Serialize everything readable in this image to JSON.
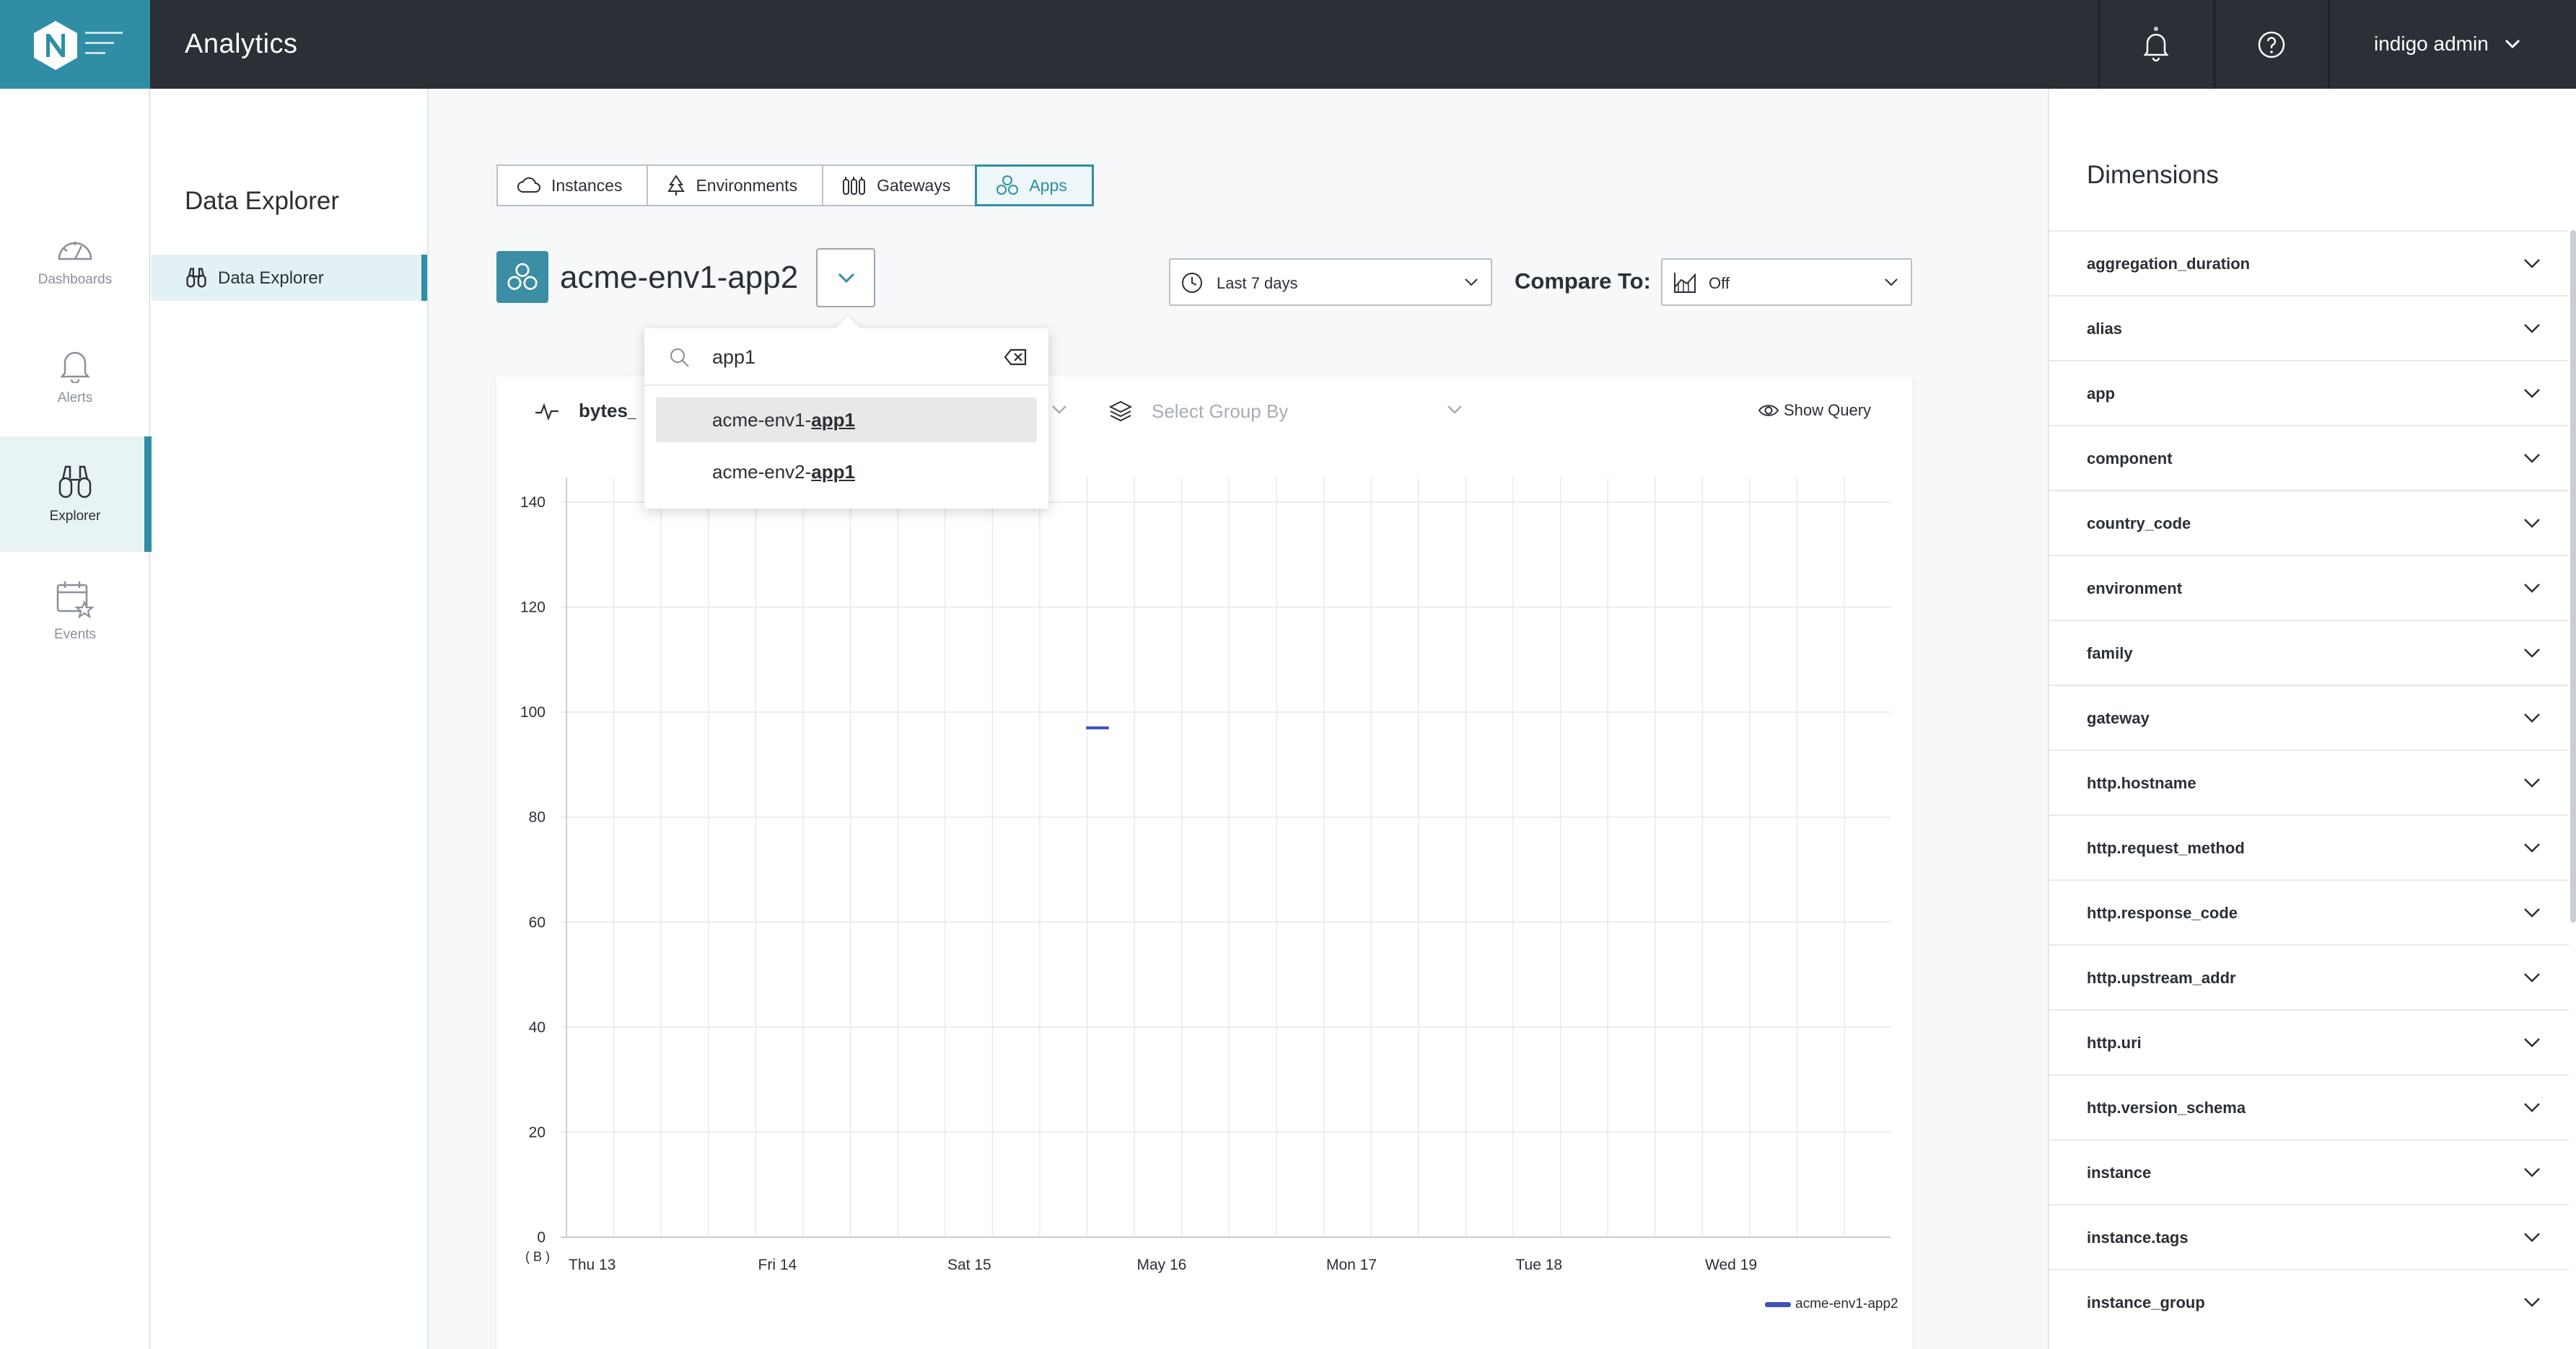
{
  "app": {
    "title": "Analytics",
    "logo_letter": "N",
    "user_name": "indigo admin",
    "accent_color": "#2f8ea5",
    "topbar_color": "#2b2f36",
    "icons": {
      "notifications": "bell-icon",
      "help": "help-icon",
      "menu": "menu-icon"
    }
  },
  "rail": {
    "items": [
      {
        "label": "Dashboards",
        "icon": "gauge-icon",
        "active": false
      },
      {
        "label": "Alerts",
        "icon": "bell-icon",
        "active": false
      },
      {
        "label": "Explorer",
        "icon": "binoculars-icon",
        "active": true
      },
      {
        "label": "Events",
        "icon": "calendar-star-icon",
        "active": false
      }
    ]
  },
  "subnav": {
    "title": "Data Explorer",
    "items": [
      {
        "label": "Data Explorer",
        "icon": "binoculars-icon",
        "active": true
      }
    ]
  },
  "tabs": [
    {
      "label": "Instances",
      "icon": "cloud-icon",
      "active": false
    },
    {
      "label": "Environments",
      "icon": "tree-icon",
      "active": false
    },
    {
      "label": "Gateways",
      "icon": "gateway-icon",
      "active": false
    },
    {
      "label": "Apps",
      "icon": "apps-icon",
      "active": true
    }
  ],
  "entity": {
    "name": "acme-env1-app2",
    "icon": "apps-icon"
  },
  "time_range": {
    "value": "Last 7 days",
    "icon": "clock-icon"
  },
  "compare": {
    "label": "Compare To:",
    "value": "Off",
    "icon": "area-chart-icon"
  },
  "dropdown": {
    "query": "app1",
    "options": [
      {
        "prefix": "acme-env1-",
        "match": "app1",
        "highlighted": true
      },
      {
        "prefix": "acme-env2-",
        "match": "app1",
        "highlighted": false
      }
    ]
  },
  "chart_toolbar": {
    "metric": "bytes_r",
    "group_by_placeholder": "Select Group By",
    "show_query_label": "Show Query"
  },
  "chart_data": {
    "type": "line",
    "x": [
      "Thu 13",
      "Fri 14",
      "Sat 15",
      "May 16",
      "Mon 17",
      "Tue 18",
      "Wed 19"
    ],
    "xlabel": "",
    "ylabel": "( B )",
    "ylim": [
      0,
      140
    ],
    "yticks": [
      0,
      20,
      40,
      60,
      80,
      100,
      120,
      140
    ],
    "grid": true,
    "legend_placement": "bottom-right",
    "series": [
      {
        "name": "acme-env1-app2",
        "color": "#3e52b8",
        "points": [
          {
            "x_day": 2.74,
            "y": 97
          },
          {
            "x_day": 2.86,
            "y": 97
          }
        ]
      }
    ]
  },
  "dimensions": {
    "title": "Dimensions",
    "items": [
      "aggregation_duration",
      "alias",
      "app",
      "component",
      "country_code",
      "environment",
      "family",
      "gateway",
      "http.hostname",
      "http.request_method",
      "http.response_code",
      "http.upstream_addr",
      "http.uri",
      "http.version_schema",
      "instance",
      "instance.tags",
      "instance_group"
    ]
  }
}
